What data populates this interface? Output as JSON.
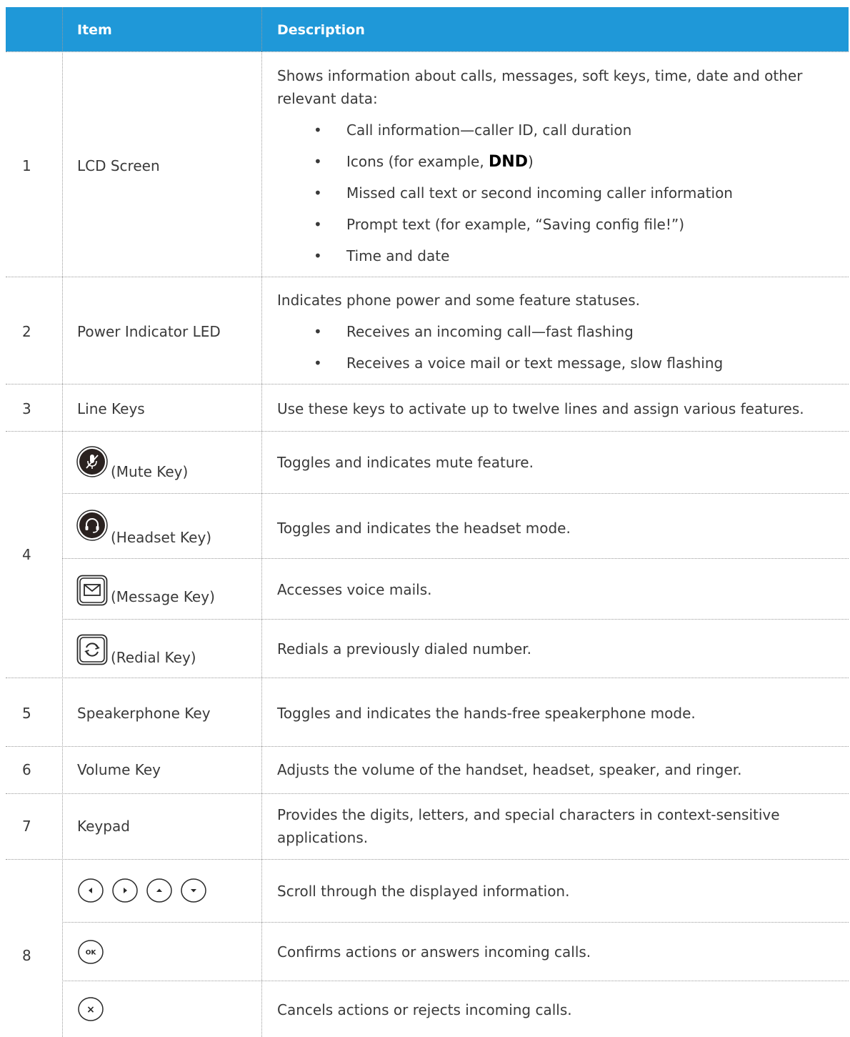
{
  "header": {
    "item": "Item",
    "description": "Description"
  },
  "rows": [
    {
      "num": "1",
      "item": "LCD Screen",
      "desc_line1": "Shows information about calls, messages, soft keys, time, date and other",
      "desc_line2": "relevant data:",
      "bullets": [
        "Call information—caller ID, call duration",
        "Icons (for example,",
        "Missed call text or second incoming caller information",
        "Prompt text (for example, “Saving config file!”)",
        "Time and date"
      ],
      "dnd_icon_text": "DND",
      "icons_close": ")"
    },
    {
      "num": "2",
      "item": "Power Indicator LED",
      "desc": "Indicates phone power and some feature statuses.",
      "bullets": [
        "Receives an incoming call—fast flashing",
        "Receives a voice mail or text message, slow flashing"
      ]
    },
    {
      "num": "3",
      "item": "Line Keys",
      "desc": "Use these keys to activate up to twelve lines and assign various features."
    },
    {
      "num": "4",
      "sub": [
        {
          "item": "(Mute Key)",
          "icon": "mute-icon",
          "desc": "Toggles and indicates mute feature."
        },
        {
          "item": "(Headset Key)",
          "icon": "headset-icon",
          "desc": "Toggles and indicates the headset mode."
        },
        {
          "item": "(Message Key)",
          "icon": "message-icon",
          "desc": "Accesses voice mails."
        },
        {
          "item": "(Redial Key)",
          "icon": "redial-icon",
          "desc": "Redials a previously dialed number."
        }
      ]
    },
    {
      "num": "5",
      "item": "Speakerphone Key",
      "desc": "Toggles and indicates the hands-free speakerphone mode."
    },
    {
      "num": "6",
      "item": "Volume Key",
      "desc": "Adjusts the volume of the handset, headset, speaker, and ringer."
    },
    {
      "num": "7",
      "item": "Keypad",
      "desc_line1": "Provides the digits, letters, and special characters in context-sensitive",
      "desc_line2": "applications."
    },
    {
      "num": "8",
      "sub": [
        {
          "icons": [
            "left-arrow-icon",
            "right-arrow-icon",
            "up-arrow-icon",
            "down-arrow-icon"
          ],
          "desc": "Scroll through the displayed information."
        },
        {
          "icon": "ok-icon",
          "icon_text": "OK",
          "desc": "Confirms actions or answers incoming calls."
        },
        {
          "icon": "cancel-icon",
          "icon_text": "×",
          "desc": "Cancels actions or rejects incoming calls."
        }
      ]
    }
  ],
  "colors": {
    "header_bg": "#1f98d8",
    "header_text": "#ffffff",
    "text": "#3a3a3a",
    "rule": "#9a9a9a"
  }
}
